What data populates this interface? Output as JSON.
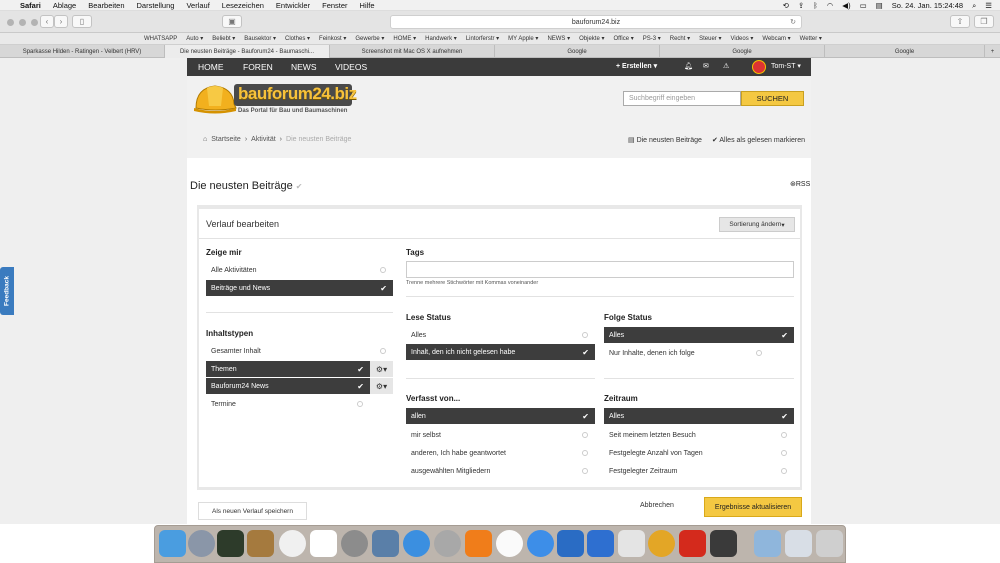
{
  "menubar": {
    "app": "Safari",
    "items": [
      "Ablage",
      "Bearbeiten",
      "Darstellung",
      "Verlauf",
      "Lesezeichen",
      "Entwickler",
      "Fenster",
      "Hilfe"
    ],
    "datetime": "So. 24. Jan.  15:24:48"
  },
  "toolbar": {
    "address": "bauforum24.biz"
  },
  "bookmarks": [
    "WHATSAPP",
    "Auto ▾",
    "Beliebt ▾",
    "Bausektor ▾",
    "Clothes ▾",
    "Feinkost ▾",
    "Gewerbe ▾",
    "HOME ▾",
    "Handwerk ▾",
    "Lintorferstr ▾",
    "MY Apple ▾",
    "NEWS ▾",
    "Objekte ▾",
    "Office ▾",
    "PS-3 ▾",
    "Recht ▾",
    "Steuer ▾",
    "Videos ▾",
    "Webcam ▾",
    "Wetter ▾"
  ],
  "tabs": [
    "Sparkasse Hilden - Ratingen - Velbert (HRV)",
    "Die neusten Beiträge - Bauforum24 - Baumaschi...",
    "Screenshot mit Mac OS X aufnehmen",
    "Google",
    "Google",
    "Google"
  ],
  "sitenav": {
    "items": [
      "HOME",
      "FOREN",
      "NEWS",
      "VIDEOS"
    ],
    "create": "Erstellen",
    "user": "Tom-ST"
  },
  "logo": {
    "name": "bauforum24.biz",
    "tagline": "Das Portal für Bau und Baumaschinen"
  },
  "search": {
    "placeholder": "Suchbegriff eingeben",
    "button": "SUCHEN"
  },
  "breadcrumb": {
    "home": "Startseite",
    "activity": "Aktivität",
    "current": "Die neusten Beiträge"
  },
  "header_links": {
    "latest": "Die neusten Beiträge",
    "mark_read": "Alles als gelesen markieren"
  },
  "page": {
    "title": "Die neusten Beiträge",
    "rss": "RSS"
  },
  "panel": {
    "title": "Verlauf bearbeiten",
    "sort": "Sortierung ändern",
    "show_me": {
      "heading": "Zeige mir",
      "options": [
        "Alle Aktivitäten",
        "Beiträge und News"
      ]
    },
    "content_types": {
      "heading": "Inhaltstypen",
      "options": [
        "Gesamter Inhalt",
        "Themen",
        "Bauforum24 News",
        "Termine"
      ]
    },
    "tags": {
      "heading": "Tags",
      "hint": "Trenne mehrere Stichwörter mit Kommas voneinander"
    },
    "read_status": {
      "heading": "Lese Status",
      "options": [
        "Alles",
        "Inhalt, den ich nicht gelesen habe"
      ]
    },
    "follow_status": {
      "heading": "Folge Status",
      "options": [
        "Alles",
        "Nur Inhalte, denen ich folge"
      ]
    },
    "author": {
      "heading": "Verfasst von...",
      "options": [
        "allen",
        "mir selbst",
        "anderen, Ich habe geantwortet",
        "ausgewählten Mitgliedern"
      ]
    },
    "timeframe": {
      "heading": "Zeitraum",
      "options": [
        "Alles",
        "Seit meinem letzten Besuch",
        "Festgelegte Anzahl von Tagen",
        "Festgelegter Zeitraum"
      ]
    }
  },
  "footer": {
    "save": "Als neuen Verlauf speichern",
    "cancel": "Abbrechen",
    "update": "Ergebnisse aktualisieren"
  },
  "feedback": "Feedback"
}
